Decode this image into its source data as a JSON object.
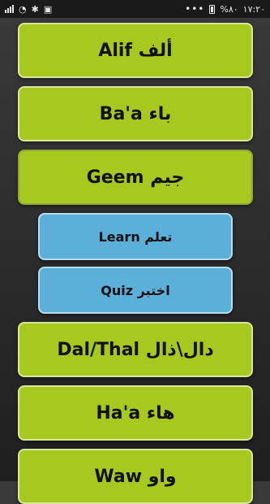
{
  "status_bar": {
    "time": "١٧:٢٠",
    "battery_percent": "%٨٠",
    "battery_level": 0.8
  },
  "letters": [
    {
      "label": "Alif ألف"
    },
    {
      "label": "Ba'a باء"
    },
    {
      "label": "Geem جيم"
    },
    {
      "label": "Dal/Thal دال\\ذال"
    },
    {
      "label": "Ha'a هاء"
    },
    {
      "label": "Waw واو"
    }
  ],
  "expanded_actions": [
    {
      "label": "Learn تعلم"
    },
    {
      "label": "Quiz اختبر"
    }
  ],
  "colors": {
    "letter_button": "#a6c81f",
    "action_button": "#5bb0d9",
    "background": "#2a2a2a"
  }
}
